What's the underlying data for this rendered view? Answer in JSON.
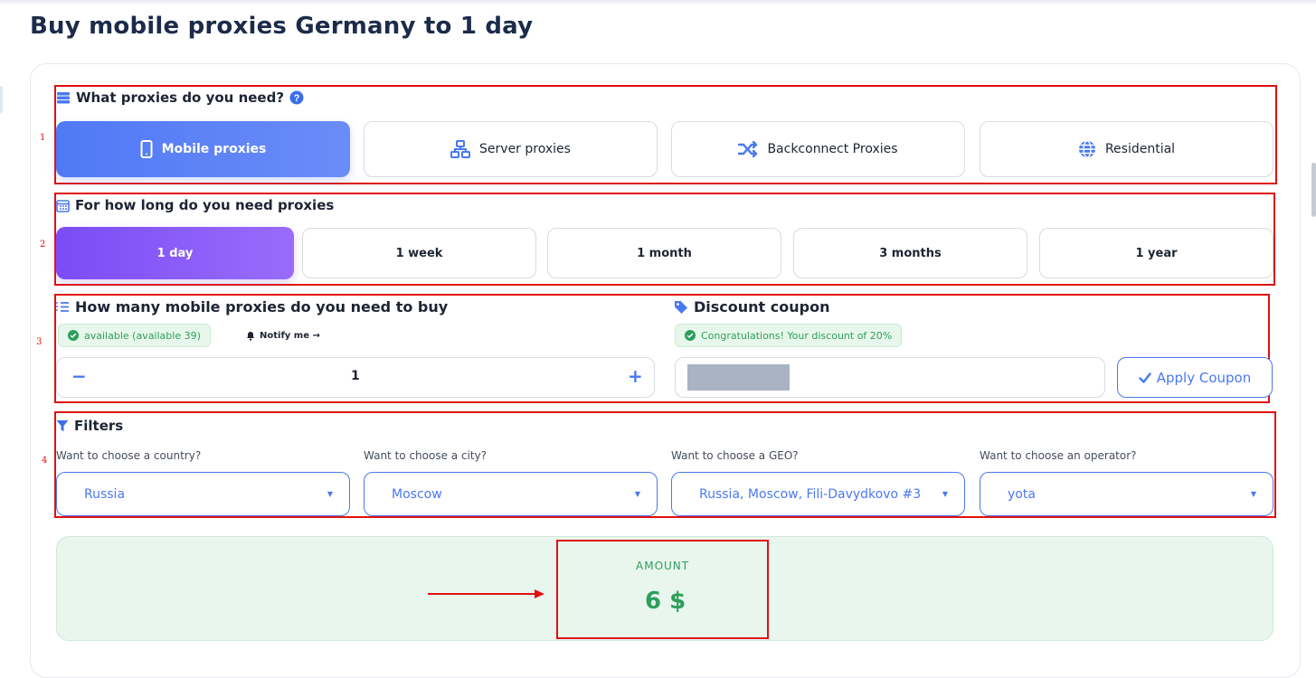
{
  "page": {
    "title": "Buy mobile proxies Germany to 1 day"
  },
  "annotations": {
    "n1": "1",
    "n2": "2",
    "n3": "3",
    "n4": "4"
  },
  "proxy_type": {
    "title": "What proxies do you need?",
    "options": [
      {
        "label": "Mobile proxies",
        "icon": "phone-icon",
        "active": true
      },
      {
        "label": "Server proxies",
        "icon": "network-icon",
        "active": false
      },
      {
        "label": "Backconnect Proxies",
        "icon": "shuffle-icon",
        "active": false
      },
      {
        "label": "Residential",
        "icon": "globe-icon",
        "active": false
      }
    ]
  },
  "duration": {
    "title": "For how long do you need proxies",
    "options": [
      {
        "label": "1 day",
        "active": true
      },
      {
        "label": "1 week",
        "active": false
      },
      {
        "label": "1 month",
        "active": false
      },
      {
        "label": "3 months",
        "active": false
      },
      {
        "label": "1 year",
        "active": false
      }
    ]
  },
  "quantity": {
    "title": "How many mobile proxies do you need to buy",
    "availability": "available (available 39)",
    "notify": "Notify me →",
    "minus": "−",
    "plus": "+",
    "value": "1"
  },
  "coupon": {
    "title": "Discount coupon",
    "message": "Congratulations! Your discount of 20%",
    "apply_label": "Apply Coupon"
  },
  "filters": {
    "title": "Filters",
    "country": {
      "label": "Want to choose a country?",
      "value": "Russia"
    },
    "city": {
      "label": "Want to choose a city?",
      "value": "Moscow"
    },
    "geo": {
      "label": "Want to choose a GEO?",
      "value": "Russia, Moscow, Fili-Davydkovo #3"
    },
    "operator": {
      "label": "Want to choose an operator?",
      "value": "yota"
    }
  },
  "amount": {
    "label": "AMOUNT",
    "value": "6 $"
  },
  "colors": {
    "accent_blue": "#4a78f0",
    "accent_purple": "#7b4cf6",
    "success_green": "#2e9e5b",
    "annotation_red": "#e01010"
  }
}
